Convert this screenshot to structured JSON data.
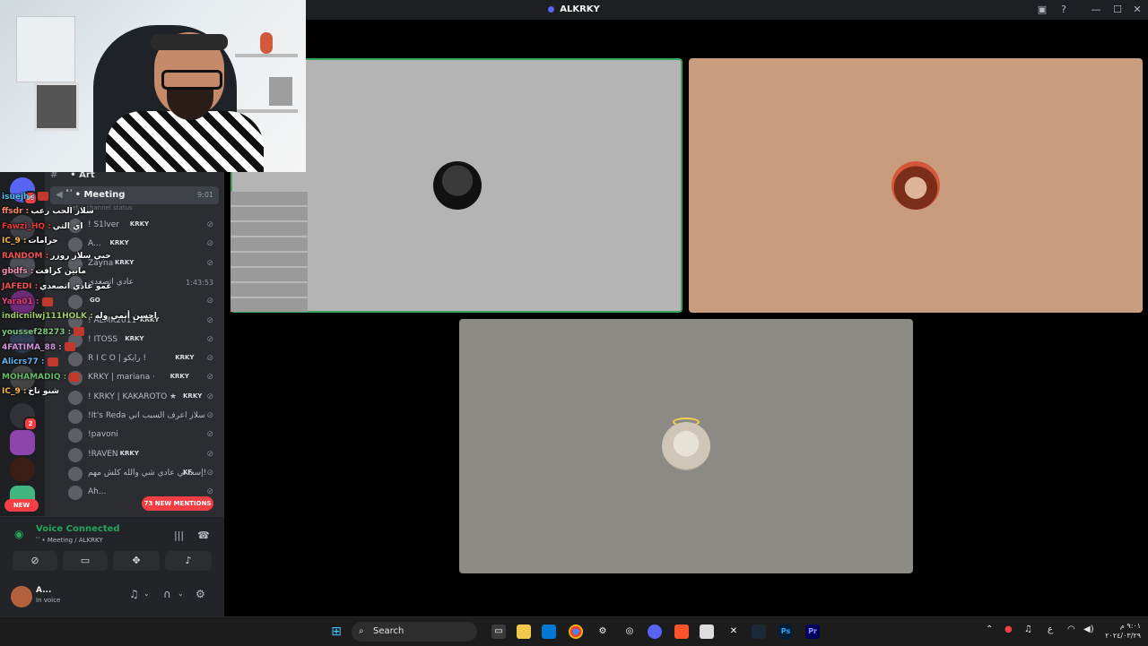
{
  "window": {
    "title": "ALKRKY"
  },
  "channels": {
    "art": "﻿ٴ ٰ • Art",
    "meeting": "﻿ٴ ٰ • Meeting",
    "meeting_time": "9:01",
    "status_placeholder": "Set a channel status"
  },
  "members": [
    {
      "name": "! S1lver",
      "tag": "KRKY"
    },
    {
      "name": "A...",
      "tag": "KRKY"
    },
    {
      "name": "Zayna",
      "tag": "KRKY"
    },
    {
      "name": "عادي اتصعدي",
      "time": "1:43:53"
    },
    {
      "name": "",
      "tag": "GO"
    },
    {
      "name": "! ALMK2011",
      "tag": "KRKY"
    },
    {
      "name": "! ITOSS",
      "tag": "KRKY"
    },
    {
      "name": "R I C O | رايكو !",
      "tag": "KRKY"
    },
    {
      "name": "KRKY | mariana ·",
      "tag": "KRKY"
    },
    {
      "name": "! KRKY | KAKAROTO ★",
      "tag": "KRKY"
    },
    {
      "name": "!It's Reda سلاز اعرف السبب اني",
      "tag": ""
    },
    {
      "name": "!pavoni",
      "tag": ""
    },
    {
      "name": "!RAVEN",
      "tag": "KRKY"
    },
    {
      "name": "إسعدني عادي شي والله كلش مهم!",
      "tag": "KF"
    },
    {
      "name": "Ah...",
      "tag": ""
    }
  ],
  "guilds": {
    "badge_top": "99",
    "badge_mid": "2",
    "new": "NEW"
  },
  "mentions": "73 NEW MENTIONS",
  "chat": [
    {
      "user": "isuejh :",
      "msg": "",
      "color": "#4fc3f7"
    },
    {
      "user": "ffsdr :",
      "msg": "سلاز الحب رعب",
      "color": "#ff8a65"
    },
    {
      "user": "Fawzi_HQ :",
      "msg": "اي التي",
      "color": "#e53935"
    },
    {
      "user": "IC_9 :",
      "msg": "حرامات",
      "color": "#ffb74d"
    },
    {
      "user": "RANDOM :",
      "msg": "حبي سلاز روزر",
      "color": "#ef5350"
    },
    {
      "user": "gbdfs :",
      "msg": "مابين كرافت",
      "color": "#f48fb1"
    },
    {
      "user": "JAFEDI :",
      "msg": "عمو عادي اتصعدي",
      "color": "#ef5350"
    },
    {
      "user": "Yara01 :",
      "msg": "",
      "color": "#ec407a"
    },
    {
      "user": "indicnilwj111HOLK :",
      "msg": "احسن أنمي وله",
      "color": "#9ccc65"
    },
    {
      "user": "youssef28273 :",
      "msg": "",
      "color": "#81c784"
    },
    {
      "user": "4FATIMA_88 :",
      "msg": "",
      "color": "#ce93d8"
    },
    {
      "user": "Alicrs77 :",
      "msg": "",
      "color": "#64b5f6"
    },
    {
      "user": "MOHAMADIQ :",
      "msg": "",
      "color": "#66bb6a"
    },
    {
      "user": "IC_9 :",
      "msg": "شنو ناخ",
      "color": "#ffb74d"
    }
  ],
  "voice": {
    "status": "Voice Connected",
    "channel": "﻿ٴ ٰ • Meeting / ALKRKY"
  },
  "user": {
    "name": "A...",
    "status": "In voice"
  },
  "taskbar": {
    "search": "Search",
    "clock_time": "٩:٠١ م",
    "clock_date": "٢٠٢٤/٠٣/٢٩"
  }
}
